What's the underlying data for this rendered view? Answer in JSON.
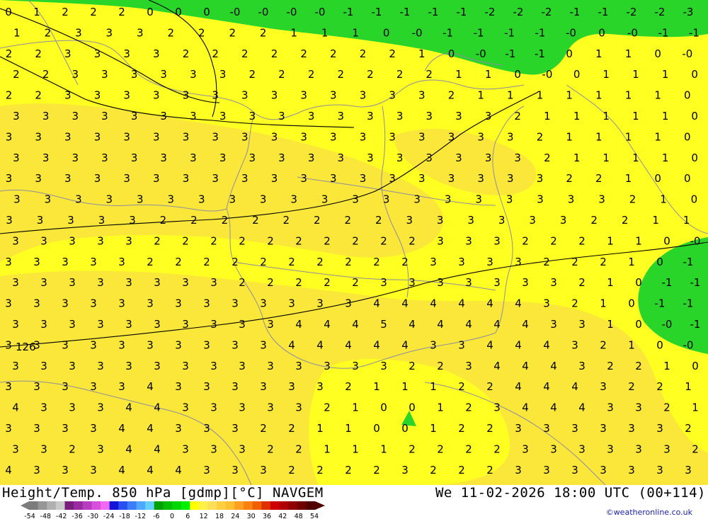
{
  "header": {
    "left_title": "Height/Temp. 850 hPa [gdmp][°C] NAVGEM",
    "right_title": "We 11-02-2026 18:00 UTC (00+114)"
  },
  "credit": "©weatheronline.co.uk",
  "map": {
    "contour_label": "126",
    "rows": [
      [
        "0",
        "1",
        "2",
        "2",
        "2",
        "0",
        "0",
        "0",
        "-0",
        "-0",
        "-0",
        "-0",
        "-1",
        "-1",
        "-1",
        "-1",
        "-1",
        "-2",
        "-2",
        "-2",
        "-1",
        "-1",
        "-2",
        "-2",
        "-3"
      ],
      [
        "1",
        "2",
        "3",
        "3",
        "3",
        "2",
        "2",
        "2",
        "2",
        "1",
        "1",
        "1",
        "0",
        "-0",
        "-1",
        "-1",
        "-1",
        "-1",
        "-0",
        "0",
        "-0",
        "-1",
        "-1"
      ],
      [
        "2",
        "2",
        "3",
        "3",
        "3",
        "3",
        "2",
        "2",
        "2",
        "2",
        "2",
        "2",
        "2",
        "2",
        "1",
        "0",
        "-0",
        "-1",
        "-1",
        "0",
        "1",
        "1",
        "0",
        "-0"
      ],
      [
        "2",
        "2",
        "3",
        "3",
        "3",
        "3",
        "3",
        "3",
        "2",
        "2",
        "2",
        "2",
        "2",
        "2",
        "2",
        "1",
        "1",
        "0",
        "-0",
        "0",
        "1",
        "1",
        "1",
        "0"
      ],
      [
        "2",
        "2",
        "3",
        "3",
        "3",
        "3",
        "3",
        "3",
        "3",
        "3",
        "3",
        "3",
        "3",
        "3",
        "3",
        "2",
        "1",
        "1",
        "1",
        "1",
        "1",
        "1",
        "1",
        "0"
      ],
      [
        "3",
        "3",
        "3",
        "3",
        "3",
        "3",
        "3",
        "3",
        "3",
        "3",
        "3",
        "3",
        "3",
        "3",
        "3",
        "3",
        "3",
        "2",
        "1",
        "1",
        "1",
        "1",
        "1",
        "0"
      ],
      [
        "3",
        "3",
        "3",
        "3",
        "3",
        "3",
        "3",
        "3",
        "3",
        "3",
        "3",
        "3",
        "3",
        "3",
        "3",
        "3",
        "3",
        "3",
        "2",
        "1",
        "1",
        "1",
        "1",
        "0"
      ],
      [
        "3",
        "3",
        "3",
        "3",
        "3",
        "3",
        "3",
        "3",
        "3",
        "3",
        "3",
        "3",
        "3",
        "3",
        "3",
        "3",
        "3",
        "3",
        "2",
        "1",
        "1",
        "1",
        "1",
        "0"
      ],
      [
        "3",
        "3",
        "3",
        "3",
        "3",
        "3",
        "3",
        "3",
        "3",
        "3",
        "3",
        "3",
        "3",
        "3",
        "3",
        "3",
        "3",
        "3",
        "3",
        "2",
        "2",
        "1",
        "0",
        "0"
      ],
      [
        "3",
        "3",
        "3",
        "3",
        "3",
        "3",
        "3",
        "3",
        "3",
        "3",
        "3",
        "3",
        "3",
        "3",
        "3",
        "3",
        "3",
        "3",
        "3",
        "3",
        "2",
        "1",
        "0"
      ],
      [
        "3",
        "3",
        "3",
        "3",
        "3",
        "2",
        "2",
        "2",
        "2",
        "2",
        "2",
        "2",
        "2",
        "3",
        "3",
        "3",
        "3",
        "3",
        "3",
        "2",
        "2",
        "1",
        "1"
      ],
      [
        "3",
        "3",
        "3",
        "3",
        "3",
        "2",
        "2",
        "2",
        "2",
        "2",
        "2",
        "2",
        "2",
        "2",
        "2",
        "3",
        "3",
        "3",
        "2",
        "2",
        "2",
        "1",
        "1",
        "0",
        "-0"
      ],
      [
        "3",
        "3",
        "3",
        "3",
        "3",
        "2",
        "2",
        "2",
        "2",
        "2",
        "2",
        "2",
        "2",
        "2",
        "2",
        "3",
        "3",
        "3",
        "3",
        "2",
        "2",
        "2",
        "1",
        "0",
        "-1"
      ],
      [
        "3",
        "3",
        "3",
        "3",
        "3",
        "3",
        "3",
        "3",
        "2",
        "2",
        "2",
        "2",
        "2",
        "3",
        "3",
        "3",
        "3",
        "3",
        "3",
        "3",
        "2",
        "1",
        "0",
        "-1",
        "-1"
      ],
      [
        "3",
        "3",
        "3",
        "3",
        "3",
        "3",
        "3",
        "3",
        "3",
        "3",
        "3",
        "3",
        "3",
        "4",
        "4",
        "4",
        "4",
        "4",
        "4",
        "3",
        "2",
        "1",
        "0",
        "-1",
        "-1"
      ],
      [
        "3",
        "3",
        "3",
        "3",
        "3",
        "3",
        "3",
        "3",
        "3",
        "3",
        "4",
        "4",
        "4",
        "5",
        "4",
        "4",
        "4",
        "4",
        "4",
        "3",
        "3",
        "1",
        "0",
        "-0",
        "-1"
      ],
      [
        "3",
        "3",
        "3",
        "3",
        "3",
        "3",
        "3",
        "3",
        "3",
        "3",
        "4",
        "4",
        "4",
        "4",
        "4",
        "3",
        "3",
        "4",
        "4",
        "4",
        "3",
        "2",
        "1",
        "0",
        "-0"
      ],
      [
        "3",
        "3",
        "3",
        "3",
        "3",
        "3",
        "3",
        "3",
        "3",
        "3",
        "3",
        "3",
        "3",
        "3",
        "2",
        "2",
        "3",
        "4",
        "4",
        "4",
        "3",
        "2",
        "2",
        "1",
        "0"
      ],
      [
        "3",
        "3",
        "3",
        "3",
        "3",
        "4",
        "3",
        "3",
        "3",
        "3",
        "3",
        "3",
        "2",
        "1",
        "1",
        "1",
        "2",
        "2",
        "4",
        "4",
        "4",
        "3",
        "2",
        "2",
        "1"
      ],
      [
        "4",
        "3",
        "3",
        "3",
        "4",
        "4",
        "3",
        "3",
        "3",
        "3",
        "3",
        "2",
        "1",
        "0",
        "0",
        "1",
        "2",
        "3",
        "4",
        "4",
        "4",
        "3",
        "3",
        "2",
        "1"
      ],
      [
        "3",
        "3",
        "3",
        "3",
        "4",
        "4",
        "3",
        "3",
        "3",
        "2",
        "2",
        "1",
        "1",
        "0",
        "0",
        "1",
        "2",
        "2",
        "3",
        "3",
        "3",
        "3",
        "3",
        "3",
        "2"
      ],
      [
        "3",
        "3",
        "2",
        "3",
        "4",
        "4",
        "3",
        "3",
        "3",
        "2",
        "2",
        "1",
        "1",
        "1",
        "2",
        "2",
        "2",
        "2",
        "3",
        "3",
        "3",
        "3",
        "3",
        "3",
        "2"
      ],
      [
        "4",
        "3",
        "3",
        "3",
        "4",
        "4",
        "4",
        "3",
        "3",
        "3",
        "2",
        "2",
        "2",
        "2",
        "3",
        "2",
        "2",
        "2",
        "3",
        "3",
        "3",
        "3",
        "3",
        "3",
        "3"
      ]
    ]
  },
  "legend": {
    "ticks": [
      "-54",
      "-48",
      "-42",
      "-36",
      "-30",
      "-24",
      "-18",
      "-12",
      "-6",
      "0",
      "6",
      "12",
      "18",
      "24",
      "30",
      "36",
      "42",
      "48",
      "54"
    ],
    "colors": [
      "#7c7c7c",
      "#969696",
      "#b0b0b0",
      "#cacaca",
      "#7a1e7e",
      "#9a2aa0",
      "#b83cc0",
      "#d650dc",
      "#f068f4",
      "#1414d8",
      "#2850f0",
      "#3c7cf8",
      "#50a8fc",
      "#64d0fc",
      "#00a000",
      "#00be00",
      "#00d600",
      "#00f000",
      "#ffff00",
      "#fff04a",
      "#fee058",
      "#fdd040",
      "#fcc030",
      "#fba020",
      "#fa8010",
      "#f06000",
      "#e03000",
      "#d00000",
      "#b00000",
      "#900000",
      "#700000",
      "#500000"
    ]
  }
}
